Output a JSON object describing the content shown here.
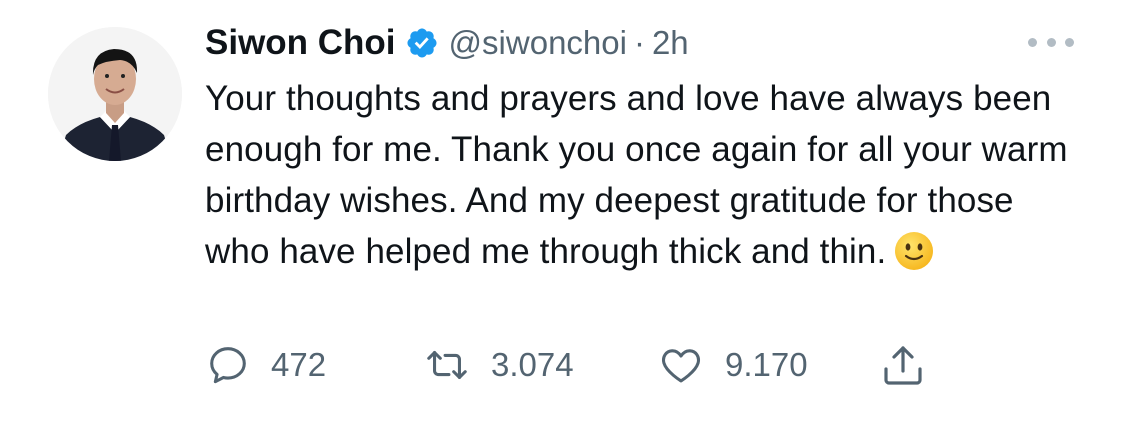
{
  "tweet": {
    "name": "Siwon Choi",
    "handle": "@siwonchoi",
    "separator": "·",
    "time": "2h",
    "text": "Your thoughts and prayers and love have always been enough for me. Thank you once again for all your warm birthday wishes. And my deepest gratitude for those who have helped me through thick and thin.",
    "actions": {
      "reply_count": "472",
      "retweet_count": "3.074",
      "like_count": "9.170"
    }
  },
  "colors": {
    "verified": "#1d9bf0",
    "secondary_text": "#536471",
    "primary_text": "#0f1419"
  },
  "icons": [
    "verified-badge-icon",
    "more-icon",
    "reply-icon",
    "retweet-icon",
    "like-icon",
    "share-icon",
    "smiling-face-emoji"
  ]
}
